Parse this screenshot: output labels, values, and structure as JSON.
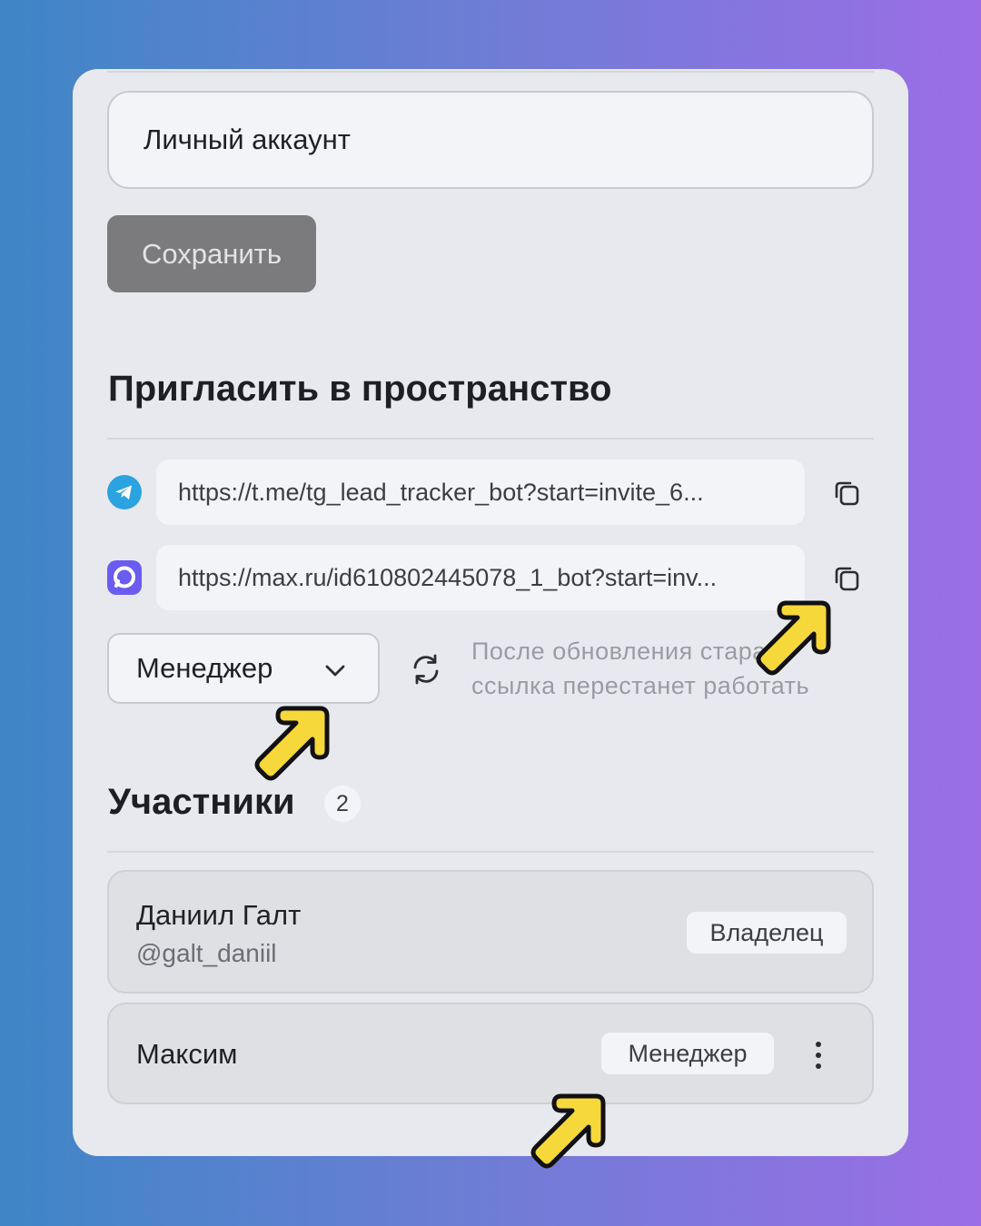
{
  "account": {
    "name_value": "Личный аккаунт",
    "save_label": "Сохранить"
  },
  "invite": {
    "title": "Пригласить в пространство",
    "links": [
      {
        "service": "telegram-icon",
        "url": "https://t.me/tg_lead_tracker_bot?start=invite_6..."
      },
      {
        "service": "max-icon",
        "url": "https://max.ru/id610802445078_1_bot?start=inv..."
      }
    ],
    "role_selected": "Менеджер",
    "note_line1": "После обновления старая",
    "note_line2": "ссылка перестанет работать"
  },
  "members": {
    "title": "Участники",
    "count": "2",
    "list": [
      {
        "name": "Даниил Галт",
        "handle": "@galt_daniil",
        "role": "Владелец"
      },
      {
        "name": "Максим",
        "role": "Менеджер"
      }
    ]
  },
  "colors": {
    "telegram": "#2aa3e0",
    "max": "#6a5cf0",
    "arrow_fill": "#f7d83a",
    "arrow_stroke": "#111111"
  }
}
